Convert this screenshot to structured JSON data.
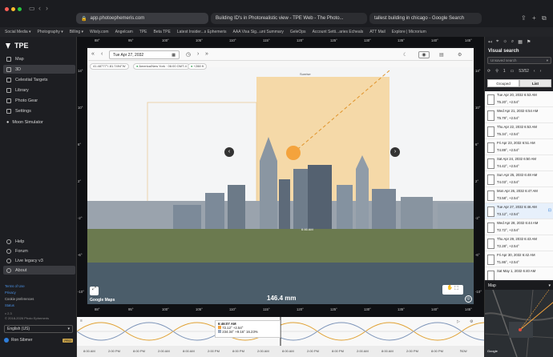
{
  "browser": {
    "sidebar_label": "Sidebar",
    "url": "app.photoephemeris.com",
    "tabs": [
      {
        "label": "app.photoephemeris.com"
      },
      {
        "label": "Building ID's in Photorealistic view - TPE Web - The Photo..."
      },
      {
        "label": "tallest building in chicago - Google Search"
      }
    ],
    "bookmarks": [
      "Social Media ▾",
      "Photography ▾",
      "Billing ▾",
      "Wiisly.com",
      "Angelcam",
      "TPE",
      "Beta TPE",
      "Latest Insider...s Ephemeris",
      "AAA Visa Sig...unt Summary",
      "GeleOps",
      "Account Setti...aries Echeals",
      "ATT Mail",
      "Explore | Microrium"
    ]
  },
  "app": {
    "logo_text": "TPE",
    "nav": [
      {
        "label": "Map",
        "icon": "map-icon",
        "active": false
      },
      {
        "label": "3D",
        "icon": "cube-icon",
        "active": true
      },
      {
        "label": "Celestial Targets",
        "icon": "target-icon",
        "active": false
      },
      {
        "label": "Library",
        "icon": "folder-icon",
        "active": false
      },
      {
        "label": "Photo Gear",
        "icon": "camera-icon",
        "active": false
      },
      {
        "label": "Settings",
        "icon": "gear-icon",
        "active": false
      }
    ],
    "moon_sim": "Moon Simulator",
    "bottom_nav": [
      {
        "label": "Help",
        "icon": "help-icon"
      },
      {
        "label": "Forum",
        "icon": "forum-icon"
      },
      {
        "label": "Live legacy v3",
        "icon": "external-icon"
      },
      {
        "label": "About",
        "icon": "info-icon"
      }
    ],
    "links": [
      "Terms of Use",
      "Privacy",
      "Cookie preferences",
      "Status"
    ],
    "version": "v 2.3",
    "copyright": "© 2018-2026 Photo Ephemeris",
    "language": "English (US)",
    "user": "Ron Sibmer",
    "user_badge": "PRO"
  },
  "viewer": {
    "date": "Tue Apr 27, 2032",
    "coords": "41.48777°/-81.7494°W",
    "timezone": "America/New York · 06:00 GMT-4",
    "elevation": "+288 ft",
    "focal": "146.4 mm",
    "sun_label": "Sunrise",
    "moon_label": "6:46 AM",
    "ruler_ticks": [
      "88°",
      "95°",
      "100°",
      "105°",
      "110°",
      "115°",
      "120°",
      "125°",
      "130°",
      "135°",
      "140°",
      "145°"
    ],
    "left_ticks": [
      "14°",
      "10°",
      "6°",
      "2°",
      "-2°",
      "-6°",
      "-10°"
    ],
    "attribution": "Google Maps"
  },
  "rpanel": {
    "title": "Visual search",
    "search_placeholder": "Unsaved search",
    "count": "1",
    "result_range": "53/52",
    "toggle_left": "Grouped",
    "toggle_right": "List",
    "results": [
      {
        "d": "Tue Apr 20, 2032 6:53 AM",
        "v": "T5.20°, +2.54°",
        "selected": false
      },
      {
        "d": "Wed Apr 21, 2032 6:54 AM",
        "v": "T5.79°, +2.54°",
        "selected": false
      },
      {
        "d": "Thu Apr 22, 2032 6:53 AM",
        "v": "T5.34°, +2.54°",
        "selected": false
      },
      {
        "d": "Fri Apr 23, 2032 6:51 AM",
        "v": "T4.89°, +2.54°",
        "selected": false
      },
      {
        "d": "Sat Apr 24, 2032 6:50 AM",
        "v": "T4.42°, +2.54°",
        "selected": false
      },
      {
        "d": "Sun Apr 25, 2032 6:48 AM",
        "v": "T4.03°, +2.54°",
        "selected": false
      },
      {
        "d": "Mon Apr 26, 2032 6:47 AM",
        "v": "T3.58°, +2.54°",
        "selected": false
      },
      {
        "d": "Tue Apr 27, 2032 6:46 AM",
        "v": "T3.12°, +2.54°",
        "selected": true
      },
      {
        "d": "Wed Apr 28, 2032 6:44 AM",
        "v": "T2.72°, +2.54°",
        "selected": false
      },
      {
        "d": "Thu Apr 29, 2032 6:43 AM",
        "v": "T2.28°, +2.54°",
        "selected": false
      },
      {
        "d": "Fri Apr 30, 2032 6:42 AM",
        "v": "T1.86°, +2.54°",
        "selected": false
      },
      {
        "d": "Sat May 1, 2032 6:40 AM",
        "v": "",
        "selected": false
      }
    ],
    "map_title": "Map",
    "map_attr": "Google"
  },
  "timeline": {
    "time": "6:46:07 AM",
    "row1": [
      "72.12°",
      "+2.54°"
    ],
    "row2": [
      "234.34°",
      "+9.16°",
      "16.23%"
    ],
    "ticks": [
      "8:00 AM",
      "2:00 PM",
      "8:00 PM",
      "2:00 AM",
      "8:00 AM",
      "2:00 PM",
      "8:00 PM",
      "2:00 AM",
      "8:00 AM",
      "2:00 PM",
      "8:00 PM",
      "2:00 AM",
      "8:00 AM",
      "2:00 PM",
      "8:00 PM"
    ],
    "right_label": "Now"
  },
  "colors": {
    "accent": "#2f7dd8",
    "sun": "#f5a623",
    "selected_row": "#e7f0fb"
  }
}
